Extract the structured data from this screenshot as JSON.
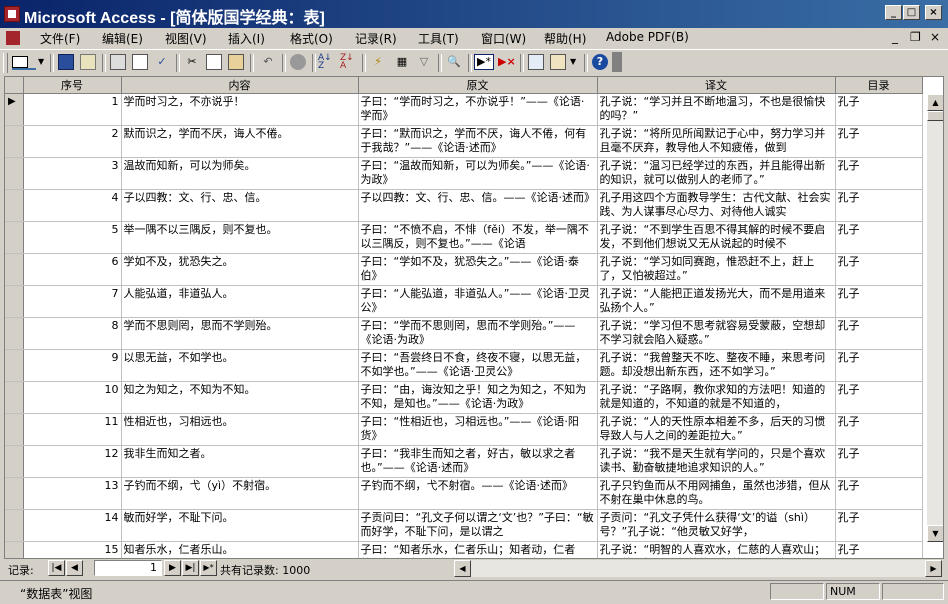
{
  "app": {
    "title": "Microsoft Access - [简体版国学经典：表]"
  },
  "menu": [
    "文件(F)",
    "编辑(E)",
    "视图(V)",
    "插入(I)",
    "格式(O)",
    "记录(R)",
    "工具(T)",
    "窗口(W)",
    "帮助(H)",
    "Adobe PDF(B)"
  ],
  "columns": [
    "序号",
    "内容",
    "原文",
    "译文",
    "目录"
  ],
  "rows": [
    {
      "no": "1",
      "content": "学而时习之，不亦说乎！",
      "orig": "子曰：“学而时习之，不亦说乎！”——《论语·学而》",
      "trans": "孔子说：“学习并且不断地温习，不也是很愉快的吗？”",
      "cat": "孔子"
    },
    {
      "no": "2",
      "content": "默而识之，学而不厌，诲人不倦。",
      "orig": "子曰：“默而识之，学而不厌，诲人不倦，何有于我哉？”——《论语·述而》",
      "trans": "孔子说：“将所见所闻默记于心中，努力学习并且毫不厌弃，教导他人不知疲倦，做到",
      "cat": "孔子"
    },
    {
      "no": "3",
      "content": "温故而知新，可以为师矣。",
      "orig": "子曰：“温故而知新，可以为师矣。”——《论语·为政》",
      "trans": "孔子说：“温习已经学过的东西，并且能得出新的知识，就可以做别人的老师了。”",
      "cat": "孔子"
    },
    {
      "no": "4",
      "content": "子以四教：文、行、忠、信。",
      "orig": "子以四教：文、行、忠、信。——《论语·述而》",
      "trans": "孔子用这四个方面教导学生：古代文献、社会实践、为人谋事尽心尽力、对待他人诚实",
      "cat": "孔子"
    },
    {
      "no": "5",
      "content": "举一隅不以三隅反，则不复也。",
      "orig": "子曰：“不愤不启，不悱（fěi）不发，举一隅不以三隅反，则不复也。”——《论语",
      "trans": "孔子说：“不到学生百思不得其解的时候不要启发，不到他们想说又无从说起的时候不",
      "cat": "孔子"
    },
    {
      "no": "6",
      "content": "学如不及，犹恐失之。",
      "orig": "子曰：“学如不及，犹恐失之。”——《论语·泰伯》",
      "trans": "孔子说：“学习如同赛跑，惟恐赶不上，赶上了，又怕被超过。”",
      "cat": "孔子"
    },
    {
      "no": "7",
      "content": "人能弘道，非道弘人。",
      "orig": "子曰：“人能弘道，非道弘人。”——《论语·卫灵公》",
      "trans": "孔子说：“人能把正道发扬光大，而不是用道来弘扬个人。”",
      "cat": "孔子"
    },
    {
      "no": "8",
      "content": "学而不思则罔，思而不学则殆。",
      "orig": "子曰：“学而不思则罔，思而不学则殆。”——《论语·为政》",
      "trans": "孔子说：“学习但不思考就容易受蒙蔽，空想却不学习就会陷入疑惑。”",
      "cat": "孔子"
    },
    {
      "no": "9",
      "content": "以思无益，不如学也。",
      "orig": "子曰：“吾尝终日不食，终夜不寝，以思无益，不如学也。”——《论语·卫灵公》",
      "trans": "孔子说：“我曾整天不吃、整夜不睡，来思考问题。却没想出新东西，还不如学习。”",
      "cat": "孔子"
    },
    {
      "no": "10",
      "content": "知之为知之，不知为不知。",
      "orig": "子曰：“由，诲汝知之乎！知之为知之，不知为不知，是知也。”——《论语·为政》",
      "trans": "孔子说：“子路啊，教你求知的方法吧！知道的就是知道的，不知道的就是不知道的，",
      "cat": "孔子"
    },
    {
      "no": "11",
      "content": "性相近也，习相远也。",
      "orig": "子曰：“性相近也，习相远也。”——《论语·阳货》",
      "trans": "孔子说：“人的天性原本相差不多，后天的习惯导致人与人之间的差距拉大。”",
      "cat": "孔子"
    },
    {
      "no": "12",
      "content": "我非生而知之者。",
      "orig": "子曰：“我非生而知之者，好古，敏以求之者也。”——《论语·述而》",
      "trans": "孔子说：“我不是天生就有学问的，只是个喜欢读书、勤奋敏捷地追求知识的人。”",
      "cat": "孔子"
    },
    {
      "no": "13",
      "content": "子钓而不纲，弋（yì）不射宿。",
      "orig": "子钓而不纲，弋不射宿。——《论语·述而》",
      "trans": "孔子只钓鱼而从不用网捕鱼，虽然也涉猎，但从不射在巢中休息的鸟。",
      "cat": "孔子"
    },
    {
      "no": "14",
      "content": "敏而好学，不耻下问。",
      "orig": "子贡问曰：“孔文子何以谓之‘文’也？”子曰：“敏而好学，不耻下问，是以谓之",
      "trans": "子贡问：“孔文子凭什么获得‘文’的谥（shì）号？”孔子说：“他灵敏又好学，",
      "cat": "孔子"
    },
    {
      "no": "15",
      "content": "知者乐水，仁者乐山。",
      "orig": "子曰：“知者乐水，仁者乐山；知者动，仁者静；知者乐，仁者寿。”——《论语·雍",
      "trans": "孔子说：“明智的人喜欢水，仁慈的人喜欢山；明智的人好动，仁慈的人好静；明智的",
      "cat": "孔子"
    },
    {
      "no": "16",
      "content": "知之者不如好之者，好之者不如乐之者。",
      "orig": "子曰：“知之者不如好之者，好之者不如乐",
      "trans": "孔子说：“对于学习一门科学来说，知道它",
      "cat": "孔子"
    }
  ],
  "nav": {
    "label": "记录:",
    "current": "1",
    "total_text": "共有记录数: 1000"
  },
  "status": {
    "view": "“数据表”视图",
    "num": "NUM"
  }
}
